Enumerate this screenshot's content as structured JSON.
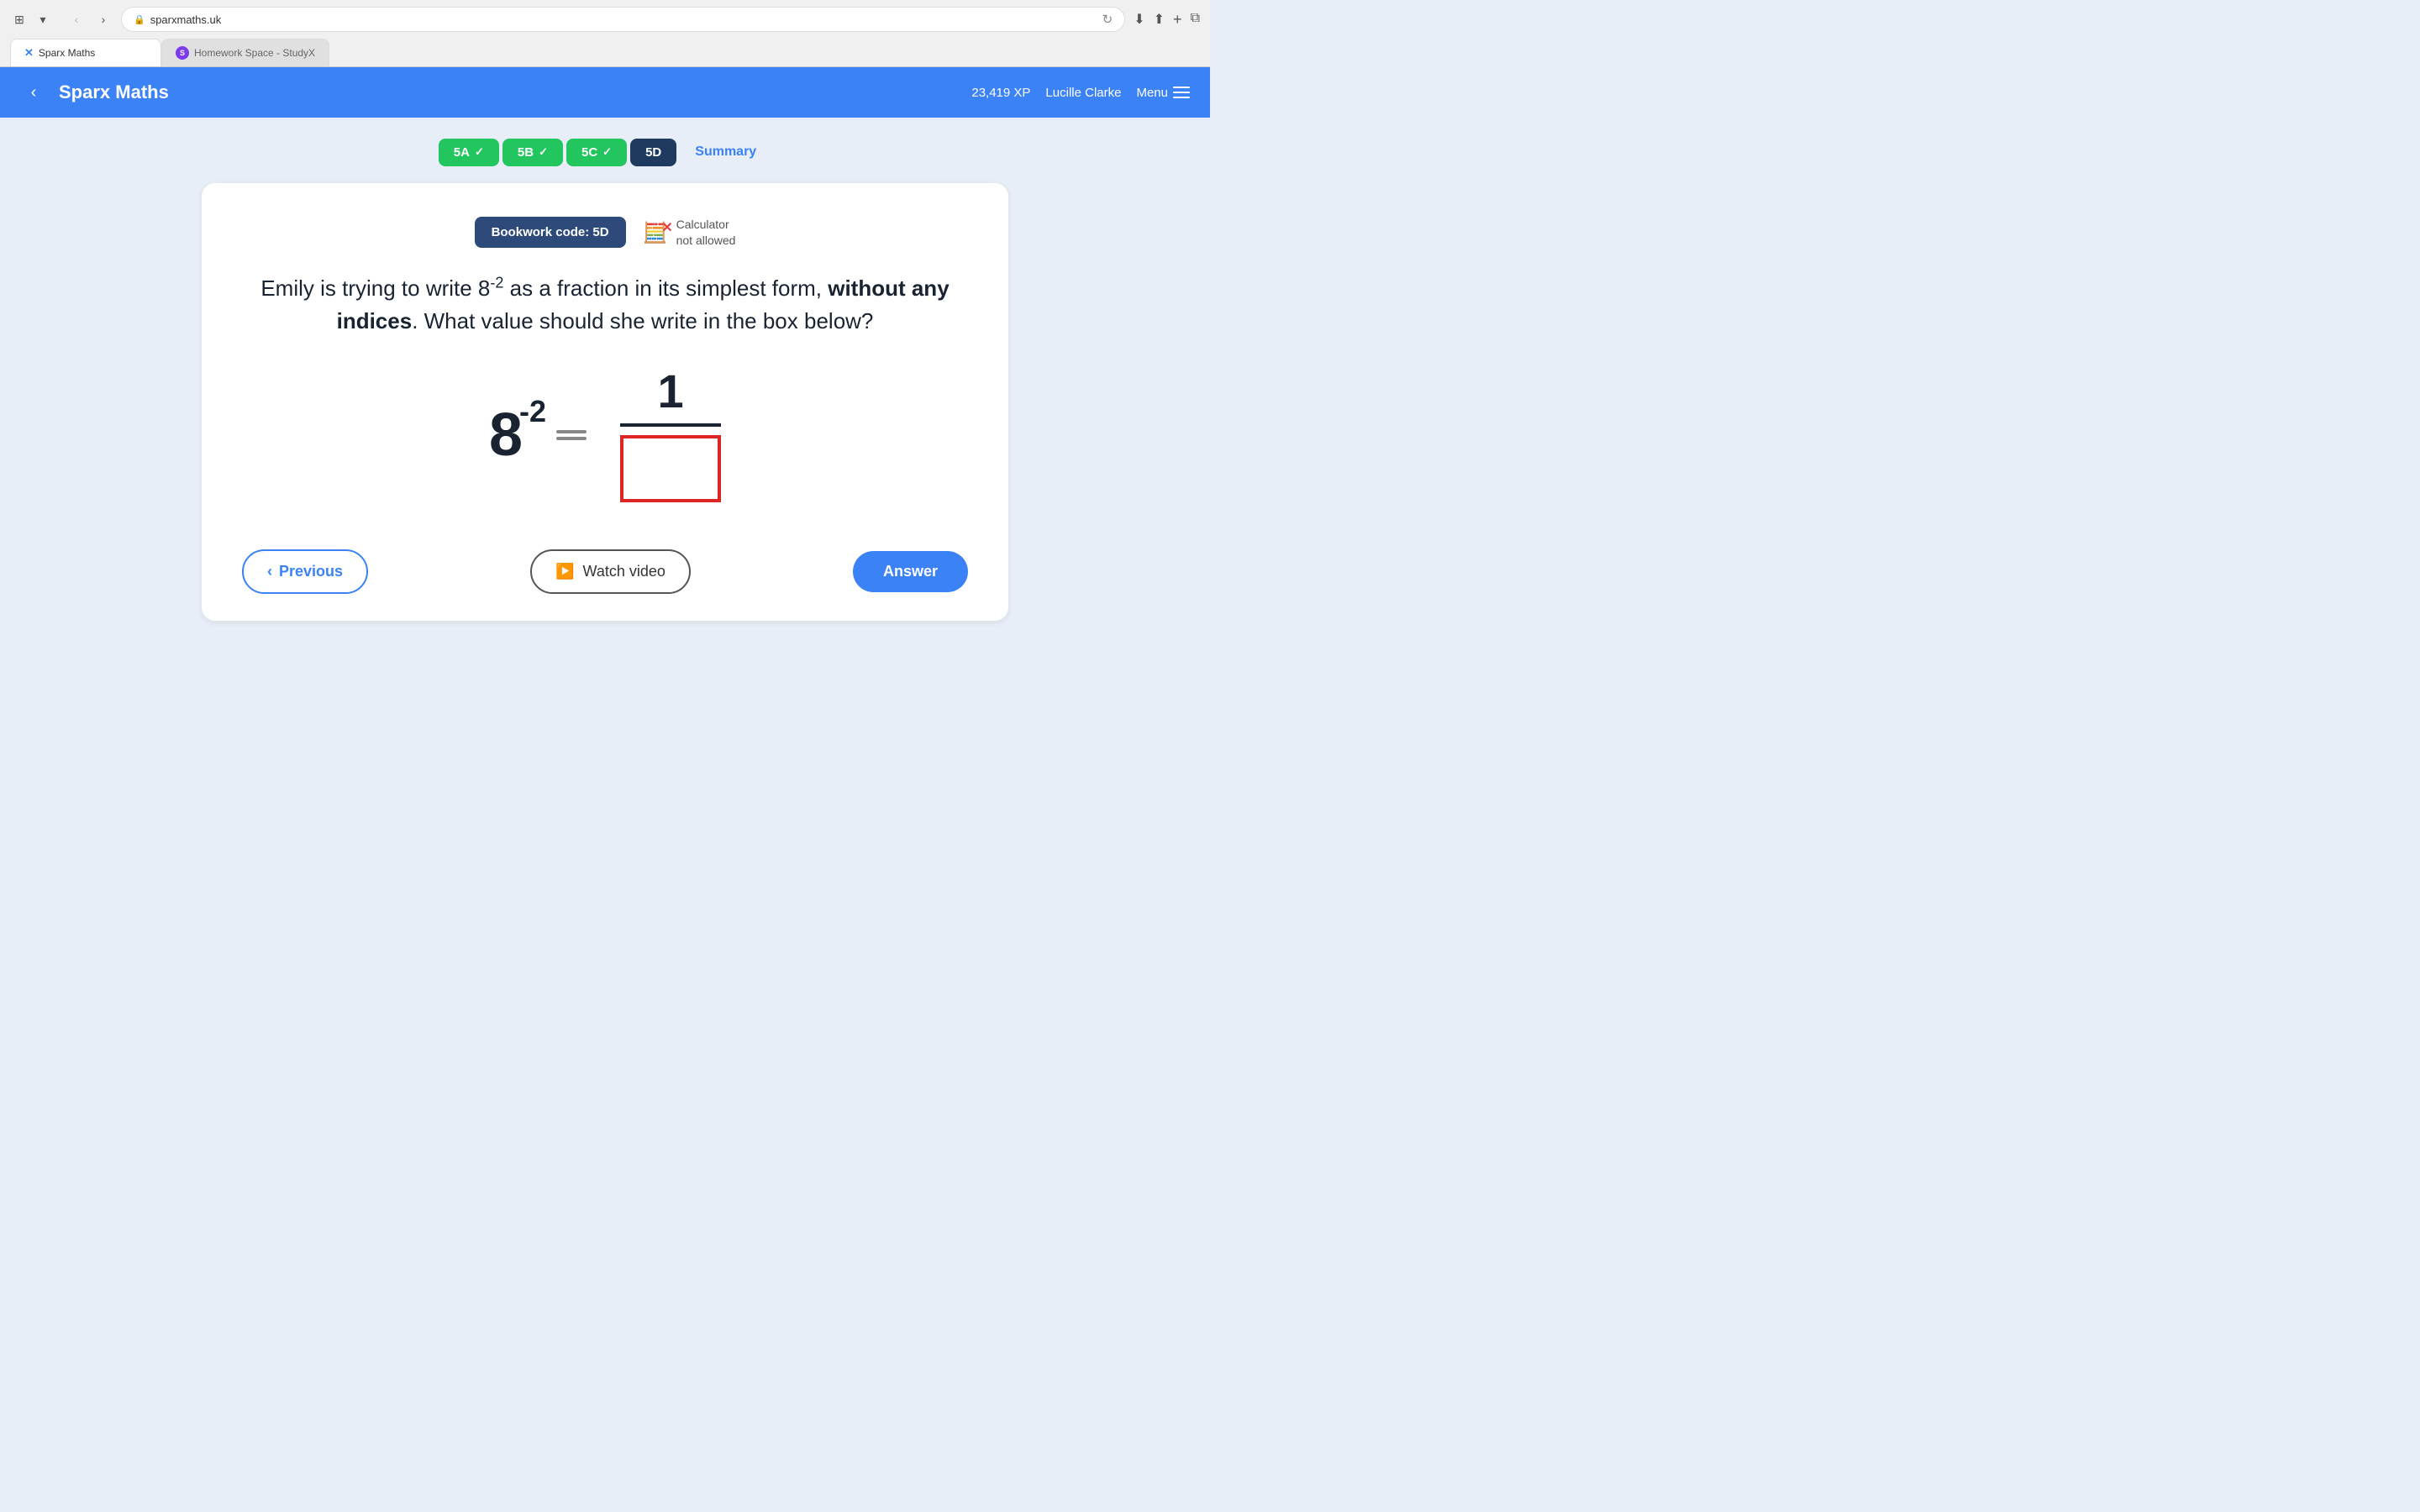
{
  "browser": {
    "address": "sparxmaths.uk",
    "tabs": [
      {
        "label": "Sparx Maths",
        "active": true,
        "icon": "X"
      },
      {
        "label": "Homework Space - StudyX",
        "active": false,
        "icon": "S"
      }
    ]
  },
  "header": {
    "title": "Sparx Maths",
    "xp": "23,419 XP",
    "user": "Lucille Clarke",
    "menu_label": "Menu"
  },
  "tabs": [
    {
      "id": "5A",
      "label": "5A",
      "state": "completed"
    },
    {
      "id": "5B",
      "label": "5B",
      "state": "completed"
    },
    {
      "id": "5C",
      "label": "5C",
      "state": "completed"
    },
    {
      "id": "5D",
      "label": "5D",
      "state": "active"
    },
    {
      "id": "summary",
      "label": "Summary",
      "state": "summary"
    }
  ],
  "card": {
    "bookwork_code": "Bookwork code: 5D",
    "calculator_label": "Calculator",
    "calculator_status": "not allowed",
    "question_text_1": "Emily is trying to write 8",
    "question_superscript": "−2",
    "question_text_2": "as a fraction in its simplest form,",
    "question_bold": "without any indices",
    "question_text_3": ". What value should she write in the box below?",
    "math_base": "8",
    "math_exponent": "-2",
    "math_numerator": "1"
  },
  "buttons": {
    "previous": "Previous",
    "watch_video": "Watch video",
    "answer": "Answer"
  }
}
